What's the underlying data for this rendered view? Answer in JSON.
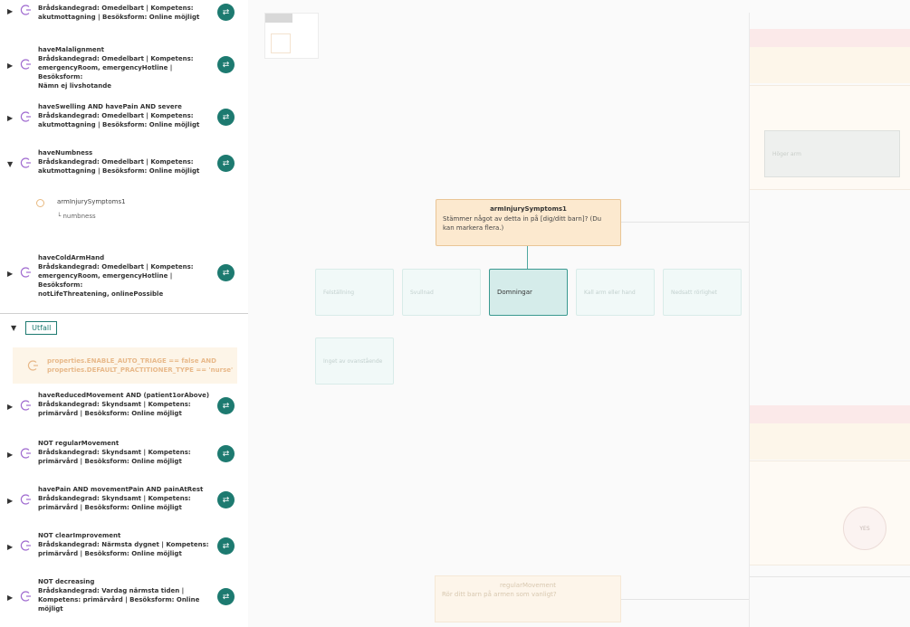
{
  "sidebar": {
    "rules_top": [
      {
        "title": "",
        "line1": "Brådskandegrad: Omedelbart | Kompetens:",
        "line2": "akutmottagning | Besöksform: Online möjligt",
        "line3": ""
      },
      {
        "title": "haveMalalignment",
        "line1": "Brådskandegrad: Omedelbart | Kompetens:",
        "line2": "emergencyRoom, emergencyHotline | Besöksform:",
        "line3": "Nämn ej livshotande"
      },
      {
        "title": "haveSwelling AND havePain AND severe",
        "line1": "Brådskandegrad: Omedelbart | Kompetens:",
        "line2": "akutmottagning | Besöksform: Online möjligt",
        "line3": ""
      },
      {
        "title": "haveNumbness",
        "line1": "Brådskandegrad: Omedelbart | Kompetens:",
        "line2": "akutmottagning | Besöksform: Online möjligt",
        "line3": ""
      },
      {
        "title": "haveColdArmHand",
        "line1": "Brådskandegrad: Omedelbart | Kompetens:",
        "line2": "emergencyRoom, emergencyHotline | Besöksform:",
        "line3": "notLifeThreatening, onlinePossible"
      }
    ],
    "expanded_node": {
      "label": "armInjurySymptoms1",
      "sub": "└ numbness"
    },
    "section_label": "Utfall",
    "condition": {
      "line1": "properties.ENABLE_AUTO_TRIAGE == false AND",
      "line2": "properties.DEFAULT_PRACTITIONER_TYPE == 'nurse'"
    },
    "rules_bottom": [
      {
        "title": "haveReducedMovement AND (patient1orAbove)",
        "line1": "Brådskandegrad: Skyndsamt | Kompetens:",
        "line2": "primärvård | Besöksform: Online möjligt",
        "line3": ""
      },
      {
        "title": "NOT regularMovement",
        "line1": "Brådskandegrad: Skyndsamt | Kompetens:",
        "line2": "primärvård | Besöksform: Online möjligt",
        "line3": ""
      },
      {
        "title": "havePain AND movementPain AND painAtRest",
        "line1": "Brådskandegrad: Skyndsamt | Kompetens:",
        "line2": "primärvård | Besöksform: Online möjligt",
        "line3": ""
      },
      {
        "title": "NOT clearImprovement",
        "line1": "Brådskandegrad: Närmsta dygnet | Kompetens:",
        "line2": "primärvård | Besöksform: Online möjligt",
        "line3": ""
      },
      {
        "title": "NOT decreasing",
        "line1": "Brådskandegrad: Vardag närmsta tiden |",
        "line2": "Kompetens: primärvård | Besöksform: Online",
        "line3": "möjligt"
      }
    ]
  },
  "canvas": {
    "question": {
      "title": "armInjurySymptoms1",
      "text": "Stämmer något av detta in på [dig/ditt barn]? (Du kan markera flera.)"
    },
    "options": [
      "Felställning",
      "Svullnad",
      "Domningar",
      "Kall arm eller hand",
      "Nedsatt rörlighet",
      "Inget av ovanstående"
    ],
    "active_option": "Domningar",
    "right_node": "Höger arm",
    "yes_label": "YES",
    "bottom_question": {
      "title": "regularMovement",
      "text": "Rör ditt barn på armen som vanligt?"
    }
  },
  "colors": {
    "accent": "#1d7a70",
    "orange_node": "#fce9cf",
    "teal_option": "#d5ecea"
  }
}
